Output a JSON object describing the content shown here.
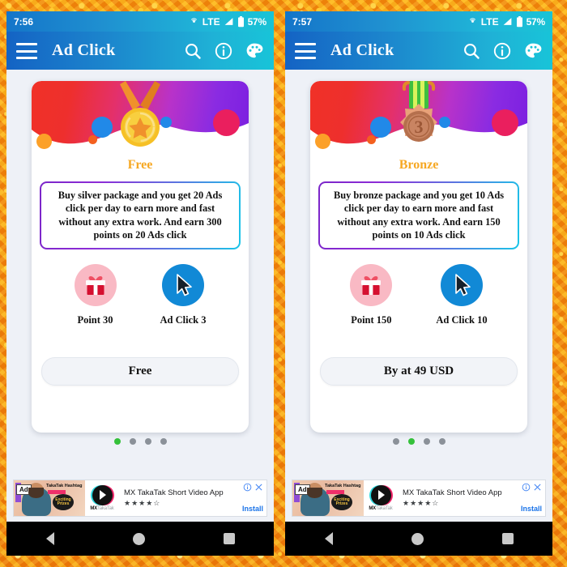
{
  "background": {
    "color": "#f5920b",
    "style": "glitter-texture"
  },
  "panels": [
    {
      "statusbar": {
        "time": "7:56",
        "network": "LTE",
        "battery_pct": "57%",
        "icons": [
          "cast-icon",
          "signal-icon",
          "battery-icon"
        ]
      },
      "appbar": {
        "title": "Ad Click",
        "menu_icon": "hamburger-icon",
        "actions": [
          "search-icon",
          "info-icon",
          "palette-icon"
        ]
      },
      "card": {
        "tier": "Free",
        "tier_color": "#f6a823",
        "medal": "gold-star-medal",
        "description": "Buy silver package and you get 20 Ads click per day to earn more and fast without any extra work. And earn 300 points on 20 Ads click",
        "perks": [
          {
            "icon": "gift-icon",
            "label": "Point 30",
            "color": "#f9b9c4"
          },
          {
            "icon": "cursor-icon",
            "label": "Ad Click 3",
            "color": "#1189d6"
          }
        ],
        "action_label": "Free"
      },
      "dots": {
        "count": 4,
        "active": 0,
        "active_color": "#35c13b",
        "inactive_color": "#8b9199"
      },
      "ad": {
        "badge": "Ad",
        "title": "MX TakaTak Short Video App",
        "stars": "★★★★☆",
        "install_label": "Install",
        "thumb_text": "TakaTak Hashtag",
        "thumb_circle_text": "Exciting Prizes",
        "logo_name": "MX",
        "logo_name_sub": "TakaTak",
        "controls": [
          "info-icon",
          "close-icon"
        ]
      },
      "navbar": {
        "buttons": [
          "back-icon",
          "home-icon",
          "recent-apps-icon"
        ]
      }
    },
    {
      "statusbar": {
        "time": "7:57",
        "network": "LTE",
        "battery_pct": "57%",
        "icons": [
          "cast-icon",
          "signal-icon",
          "battery-icon"
        ]
      },
      "appbar": {
        "title": "Ad Click",
        "menu_icon": "hamburger-icon",
        "actions": [
          "search-icon",
          "info-icon",
          "palette-icon"
        ]
      },
      "card": {
        "tier": "Bronze",
        "tier_color": "#f6a823",
        "medal": "bronze-3-medal",
        "description": "Buy bronze package and you get 10 Ads click per day to earn more and fast without any extra work. And earn 150 points on 10 Ads click",
        "perks": [
          {
            "icon": "gift-icon",
            "label": "Point 150",
            "color": "#f9b9c4"
          },
          {
            "icon": "cursor-icon",
            "label": "Ad Click 10",
            "color": "#1189d6"
          }
        ],
        "action_label": "By at 49 USD"
      },
      "dots": {
        "count": 4,
        "active": 1,
        "active_color": "#35c13b",
        "inactive_color": "#8b9199"
      },
      "ad": {
        "badge": "Ad",
        "title": "MX TakaTak Short Video App",
        "stars": "★★★★☆",
        "install_label": "Install",
        "thumb_text": "TakaTak Hashtag",
        "thumb_circle_text": "Exciting Prizes",
        "logo_name": "MX",
        "logo_name_sub": "TakaTak",
        "controls": [
          "info-icon",
          "close-icon"
        ]
      },
      "navbar": {
        "buttons": [
          "back-icon",
          "home-icon",
          "recent-apps-icon"
        ]
      }
    }
  ]
}
